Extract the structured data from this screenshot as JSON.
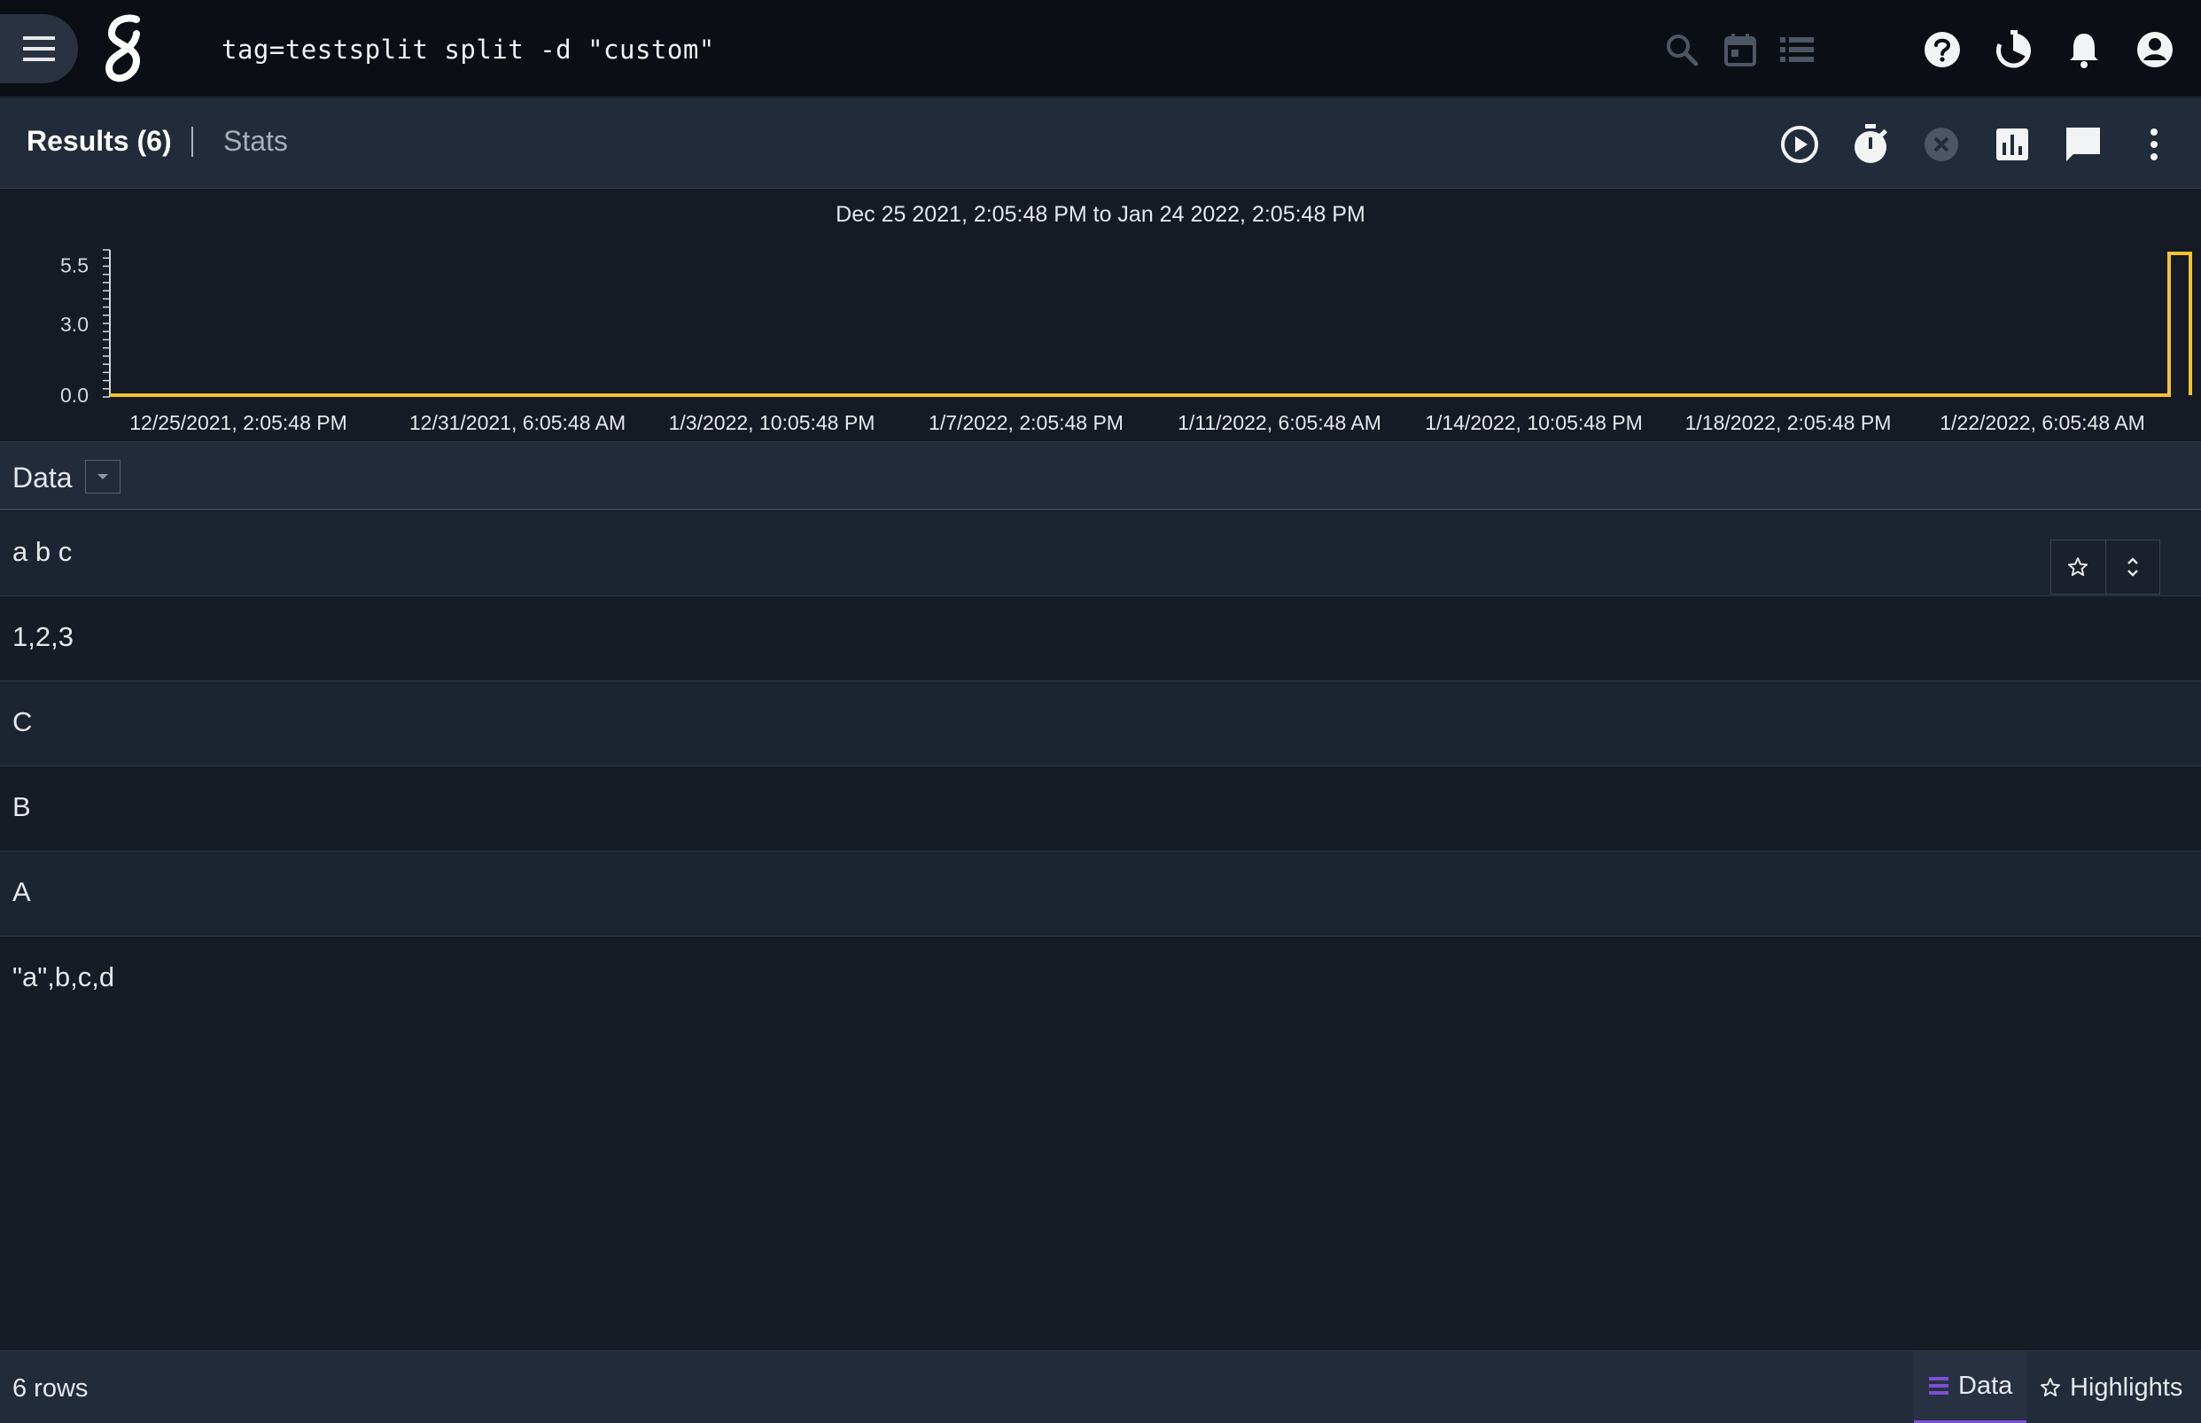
{
  "topbar": {
    "query": "tag=testsplit split -d \"custom\"",
    "icons": [
      "menu-icon",
      "logo",
      "search-icon",
      "calendar-icon",
      "list-icon",
      "help-icon",
      "history-icon",
      "notifications-icon",
      "account-icon"
    ]
  },
  "results_bar": {
    "results_tab": "Results (6)",
    "stats_tab": "Stats",
    "icons": [
      "play-icon",
      "timer-icon",
      "cancel-icon",
      "chart-icon",
      "comment-icon",
      "more-vert-icon"
    ]
  },
  "chart_data": {
    "type": "bar",
    "title": "Dec 25 2021, 2:05:48 PM to Jan 24 2022, 2:05:48 PM",
    "xlabel": "",
    "ylabel": "",
    "y_ticks": [
      "5.5",
      "3.0",
      "0.0"
    ],
    "ylim": [
      0,
      6
    ],
    "x_tick_labels": [
      "12/25/2021, 2:05:48 PM",
      "12/31/2021, 6:05:48 AM",
      "1/3/2022, 10:05:48 PM",
      "1/7/2022, 2:05:48 PM",
      "1/11/2022, 6:05:48 AM",
      "1/14/2022, 10:05:48 PM",
      "1/18/2022, 2:05:48 PM",
      "1/22/2022, 6:05:48 AM"
    ],
    "series": [
      {
        "values": [
          0,
          0,
          0,
          0,
          0,
          0,
          0,
          0,
          6
        ]
      }
    ],
    "color": "#f2c230",
    "grid": false
  },
  "table": {
    "column_header": "Data",
    "rows": [
      "a b c",
      "1,2,3",
      "C",
      "B",
      "A",
      "\"a\",b,c,d"
    ]
  },
  "footer": {
    "row_count": "6 rows",
    "data_tab": "Data",
    "highlights_tab": "Highlights"
  },
  "colors": {
    "accent": "#7b4fd6",
    "chart": "#f2c230",
    "background": "#161b26",
    "topbar": "#0b0e14"
  }
}
